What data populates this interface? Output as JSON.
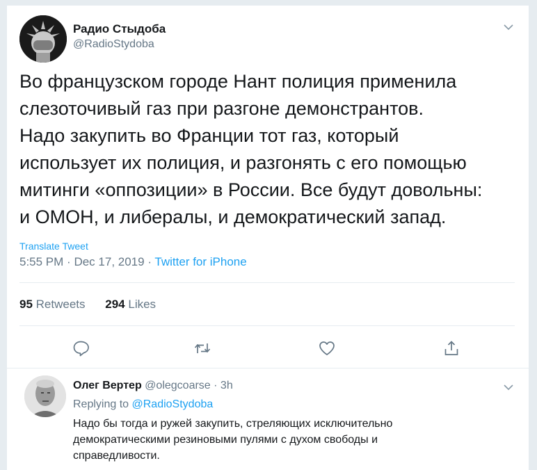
{
  "main_tweet": {
    "author_name": "Радио Стыдоба",
    "author_handle": "@RadioStydoba",
    "text": "Во французском городе Нант полиция применила\nслезоточивый газ при разгоне демонстрантов.\nНадо закупить во Франции тот газ, который\nиспользует их полиция, и разгонять с его помощью\nмитинги «оппозиции» в России. Все будут довольны:\nи ОМОН, и либералы, и демократический запад.",
    "translate_label": "Translate Tweet",
    "time": "5:55 PM",
    "date": "Dec 17, 2019",
    "separator": "·",
    "source": "Twitter for iPhone",
    "retweets_count": "95",
    "retweets_label": "Retweets",
    "likes_count": "294",
    "likes_label": "Likes"
  },
  "actions": {
    "icons": [
      "reply-icon",
      "retweet-icon",
      "like-icon",
      "share-icon"
    ]
  },
  "reply": {
    "author_name": "Олег Вертер",
    "author_handle": "@olegcoarse",
    "separator": "·",
    "time_ago": "3h",
    "replying_to_label": "Replying to",
    "replying_to_handle": "@RadioStydoba",
    "text": "Надо бы тогда и ружей закупить, стреляющих исключительно\nдемократическими резиновыми пулями с духом свободы и\nсправедливости."
  },
  "colors": {
    "accent": "#1da1f2",
    "muted": "#657786",
    "text": "#14171a",
    "border": "#e6ecf0"
  }
}
